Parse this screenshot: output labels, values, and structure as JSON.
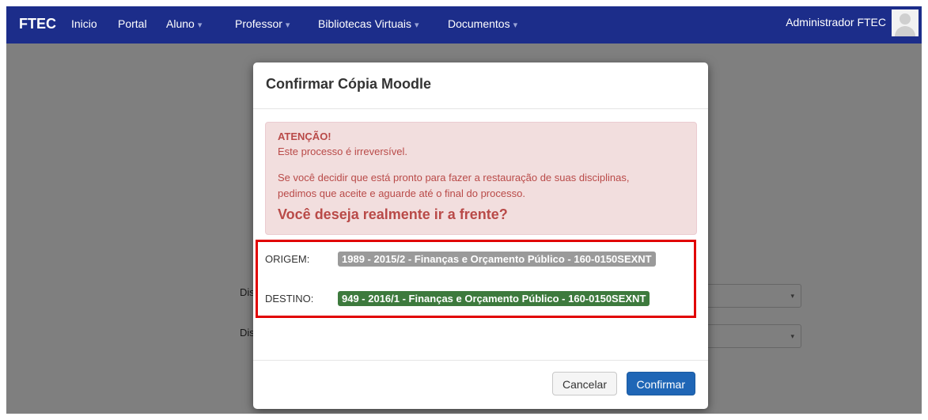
{
  "navbar": {
    "brand": "FTEC",
    "items": [
      {
        "label": "Inicio",
        "has_caret": false
      },
      {
        "label": "Portal",
        "has_caret": false
      },
      {
        "label": "Aluno",
        "has_caret": true
      },
      {
        "label": "Professor",
        "has_caret": true
      },
      {
        "label": "Bibliotecas Virtuais",
        "has_caret": true
      },
      {
        "label": "Documentos",
        "has_caret": true
      }
    ],
    "user": "Administrador FTEC",
    "avatar_icon": "user-avatar-icon",
    "caret_glyph": "▾",
    "bg_color": "#1c2d8a"
  },
  "background_page": {
    "label_1": "Dis",
    "label_2": "Dis",
    "select_arrow": "▾"
  },
  "modal": {
    "title": "Confirmar Cópia Moodle",
    "alert": {
      "title": "ATENÇÃO!",
      "line1": "Este processo é irreversível.",
      "line2": "Se você decidir que está pronto para fazer a restauração de suas disciplinas,",
      "line3": "pedimos que aceite e aguarde até o final do processo.",
      "question": "Você deseja realmente ir a frente?"
    },
    "origem_label": "ORIGEM:",
    "origem_value": "1989 - 2015/2 - Finanças e Orçamento Público - 160-0150SEXNT",
    "destino_label": "DESTINO:",
    "destino_value": "949 - 2016/1 - Finanças e Orçamento Público - 160-0150SEXNT",
    "cancel_label": "Cancelar",
    "confirm_label": "Confirmar",
    "colors": {
      "alert_text": "#b94a48",
      "alert_bg": "#f2dede",
      "origem_badge": "#9a9a9a",
      "destino_badge": "#3d7a3d",
      "highlight_border": "#e10000",
      "primary": "#1f66b6"
    }
  }
}
